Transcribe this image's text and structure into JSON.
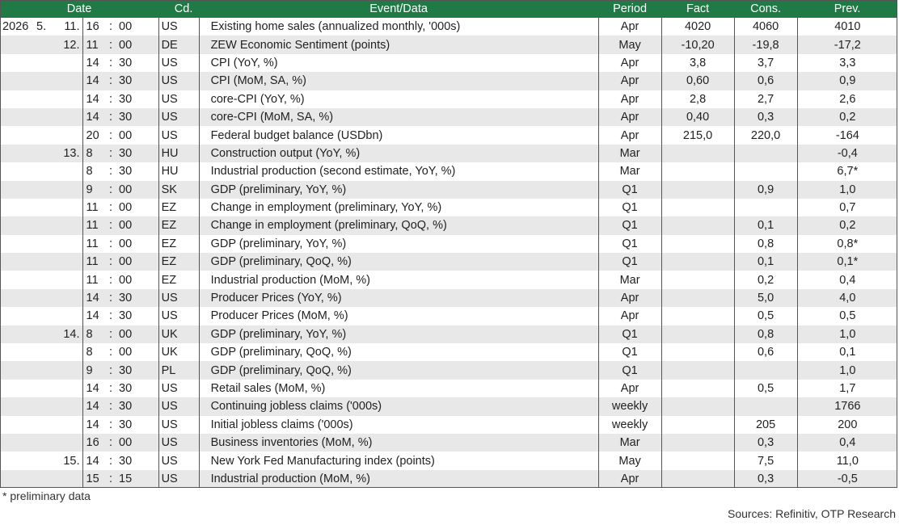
{
  "header": {
    "date": "Date",
    "code": "Cd.",
    "event": "Event/Data",
    "period": "Period",
    "fact": "Fact",
    "cons": "Cons.",
    "prev": "Prev."
  },
  "rows": [
    {
      "year": "2026",
      "month": "5.",
      "day": "11.",
      "hh": "16",
      "sep": ":",
      "mm": "00",
      "cd": "US",
      "event": "Existing home sales (annualized monthly, '000s)",
      "period": "Apr",
      "fact": "4020",
      "cons": "4060",
      "prev": "4010"
    },
    {
      "year": "",
      "month": "",
      "day": "12.",
      "hh": "11",
      "sep": ":",
      "mm": "00",
      "cd": "DE",
      "event": "ZEW Economic Sentiment (points)",
      "period": "May",
      "fact": "-10,20",
      "cons": "-19,8",
      "prev": "-17,2"
    },
    {
      "year": "",
      "month": "",
      "day": "",
      "hh": "14",
      "sep": ":",
      "mm": "30",
      "cd": "US",
      "event": "CPI (YoY, %)",
      "period": "Apr",
      "fact": "3,8",
      "cons": "3,7",
      "prev": "3,3"
    },
    {
      "year": "",
      "month": "",
      "day": "",
      "hh": "14",
      "sep": ":",
      "mm": "30",
      "cd": "US",
      "event": "CPI (MoM, SA, %)",
      "period": "Apr",
      "fact": "0,60",
      "cons": "0,6",
      "prev": "0,9"
    },
    {
      "year": "",
      "month": "",
      "day": "",
      "hh": "14",
      "sep": ":",
      "mm": "30",
      "cd": "US",
      "event": "core-CPI (YoY, %)",
      "period": "Apr",
      "fact": "2,8",
      "cons": "2,7",
      "prev": "2,6"
    },
    {
      "year": "",
      "month": "",
      "day": "",
      "hh": "14",
      "sep": ":",
      "mm": "30",
      "cd": "US",
      "event": "core-CPI (MoM, SA, %)",
      "period": "Apr",
      "fact": "0,40",
      "cons": "0,3",
      "prev": "0,2"
    },
    {
      "year": "",
      "month": "",
      "day": "",
      "hh": "20",
      "sep": ":",
      "mm": "00",
      "cd": "US",
      "event": "Federal budget balance (USDbn)",
      "period": "Apr",
      "fact": "215,0",
      "cons": "220,0",
      "prev": "-164"
    },
    {
      "year": "",
      "month": "",
      "day": "13.",
      "hh": "8",
      "sep": ":",
      "mm": "30",
      "cd": "HU",
      "event": "Construction output (YoY, %)",
      "period": "Mar",
      "fact": "",
      "cons": "",
      "prev": "-0,4"
    },
    {
      "year": "",
      "month": "",
      "day": "",
      "hh": "8",
      "sep": ":",
      "mm": "30",
      "cd": "HU",
      "event": "Industrial production (second estimate, YoY, %)",
      "period": "Mar",
      "fact": "",
      "cons": "",
      "prev": "6,7*"
    },
    {
      "year": "",
      "month": "",
      "day": "",
      "hh": "9",
      "sep": ":",
      "mm": "00",
      "cd": "SK",
      "event": "GDP (preliminary, YoY, %)",
      "period": "Q1",
      "fact": "",
      "cons": "0,9",
      "prev": "1,0"
    },
    {
      "year": "",
      "month": "",
      "day": "",
      "hh": "11",
      "sep": ":",
      "mm": "00",
      "cd": "EZ",
      "event": "Change in employment (preliminary, YoY, %)",
      "period": "Q1",
      "fact": "",
      "cons": "",
      "prev": "0,7"
    },
    {
      "year": "",
      "month": "",
      "day": "",
      "hh": "11",
      "sep": ":",
      "mm": "00",
      "cd": "EZ",
      "event": "Change in employment (preliminary, QoQ, %)",
      "period": "Q1",
      "fact": "",
      "cons": "0,1",
      "prev": "0,2"
    },
    {
      "year": "",
      "month": "",
      "day": "",
      "hh": "11",
      "sep": ":",
      "mm": "00",
      "cd": "EZ",
      "event": "GDP (preliminary, YoY, %)",
      "period": "Q1",
      "fact": "",
      "cons": "0,8",
      "prev": "0,8*"
    },
    {
      "year": "",
      "month": "",
      "day": "",
      "hh": "11",
      "sep": ":",
      "mm": "00",
      "cd": "EZ",
      "event": "GDP (preliminary, QoQ, %)",
      "period": "Q1",
      "fact": "",
      "cons": "0,1",
      "prev": "0,1*"
    },
    {
      "year": "",
      "month": "",
      "day": "",
      "hh": "11",
      "sep": ":",
      "mm": "00",
      "cd": "EZ",
      "event": "Industrial production (MoM, %)",
      "period": "Mar",
      "fact": "",
      "cons": "0,2",
      "prev": "0,4"
    },
    {
      "year": "",
      "month": "",
      "day": "",
      "hh": "14",
      "sep": ":",
      "mm": "30",
      "cd": "US",
      "event": "Producer Prices (YoY, %)",
      "period": "Apr",
      "fact": "",
      "cons": "5,0",
      "prev": "4,0"
    },
    {
      "year": "",
      "month": "",
      "day": "",
      "hh": "14",
      "sep": ":",
      "mm": "30",
      "cd": "US",
      "event": "Producer Prices (MoM, %)",
      "period": "Apr",
      "fact": "",
      "cons": "0,5",
      "prev": "0,5"
    },
    {
      "year": "",
      "month": "",
      "day": "14.",
      "hh": "8",
      "sep": ":",
      "mm": "00",
      "cd": "UK",
      "event": "GDP (preliminary, YoY, %)",
      "period": "Q1",
      "fact": "",
      "cons": "0,8",
      "prev": "1,0"
    },
    {
      "year": "",
      "month": "",
      "day": "",
      "hh": "8",
      "sep": ":",
      "mm": "00",
      "cd": "UK",
      "event": "GDP (preliminary, QoQ, %)",
      "period": "Q1",
      "fact": "",
      "cons": "0,6",
      "prev": "0,1"
    },
    {
      "year": "",
      "month": "",
      "day": "",
      "hh": "9",
      "sep": ":",
      "mm": "30",
      "cd": "PL",
      "event": "GDP (preliminary, QoQ, %)",
      "period": "Q1",
      "fact": "",
      "cons": "",
      "prev": "1,0"
    },
    {
      "year": "",
      "month": "",
      "day": "",
      "hh": "14",
      "sep": ":",
      "mm": "30",
      "cd": "US",
      "event": "Retail sales (MoM, %)",
      "period": "Apr",
      "fact": "",
      "cons": "0,5",
      "prev": "1,7"
    },
    {
      "year": "",
      "month": "",
      "day": "",
      "hh": "14",
      "sep": ":",
      "mm": "30",
      "cd": "US",
      "event": "Continuing jobless claims ('000s)",
      "period": "weekly",
      "fact": "",
      "cons": "",
      "prev": "1766"
    },
    {
      "year": "",
      "month": "",
      "day": "",
      "hh": "14",
      "sep": ":",
      "mm": "30",
      "cd": "US",
      "event": "Initial jobless claims ('000s)",
      "period": "weekly",
      "fact": "",
      "cons": "205",
      "prev": "200"
    },
    {
      "year": "",
      "month": "",
      "day": "",
      "hh": "16",
      "sep": ":",
      "mm": "00",
      "cd": "US",
      "event": "Business inventories (MoM, %)",
      "period": "Mar",
      "fact": "",
      "cons": "0,3",
      "prev": "0,4"
    },
    {
      "year": "",
      "month": "",
      "day": "15.",
      "hh": "14",
      "sep": ":",
      "mm": "30",
      "cd": "US",
      "event": "New York Fed Manufacturing index (points)",
      "period": "May",
      "fact": "",
      "cons": "7,5",
      "prev": "11,0"
    },
    {
      "year": "",
      "month": "",
      "day": "",
      "hh": "15",
      "sep": ":",
      "mm": "15",
      "cd": "US",
      "event": "Industrial production (MoM, %)",
      "period": "Apr",
      "fact": "",
      "cons": "0,3",
      "prev": "-0,5"
    }
  ],
  "footer": {
    "note": "* preliminary data",
    "sources": "Sources: Refinitiv, OTP Research"
  },
  "colors": {
    "header_bg": "#1f7a45",
    "row_stripe": "#e8e8e8"
  }
}
